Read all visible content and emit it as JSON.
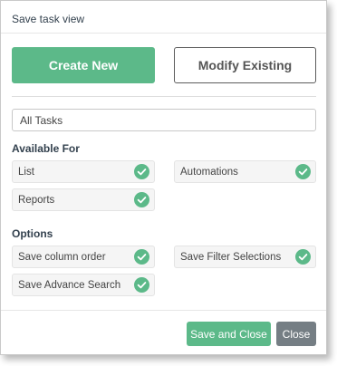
{
  "dialog": {
    "title": "Save task view"
  },
  "mode": {
    "create_label": "Create New",
    "modify_label": "Modify Existing"
  },
  "view_name": {
    "value": "All Tasks"
  },
  "available_for": {
    "heading": "Available For",
    "items": [
      {
        "label": "List",
        "checked": true
      },
      {
        "label": "Automations",
        "checked": true
      },
      {
        "label": "Reports",
        "checked": true
      }
    ]
  },
  "options": {
    "heading": "Options",
    "items": [
      {
        "label": "Save column order",
        "checked": true
      },
      {
        "label": "Save Filter Selections",
        "checked": true
      },
      {
        "label": "Save Advance Search",
        "checked": true
      }
    ]
  },
  "footer": {
    "save_label": "Save and Close",
    "close_label": "Close"
  },
  "colors": {
    "accent": "#5cb989",
    "close_button": "#757e84",
    "heading_text": "#33414e"
  },
  "icons": {
    "check": "check-circle-icon"
  }
}
